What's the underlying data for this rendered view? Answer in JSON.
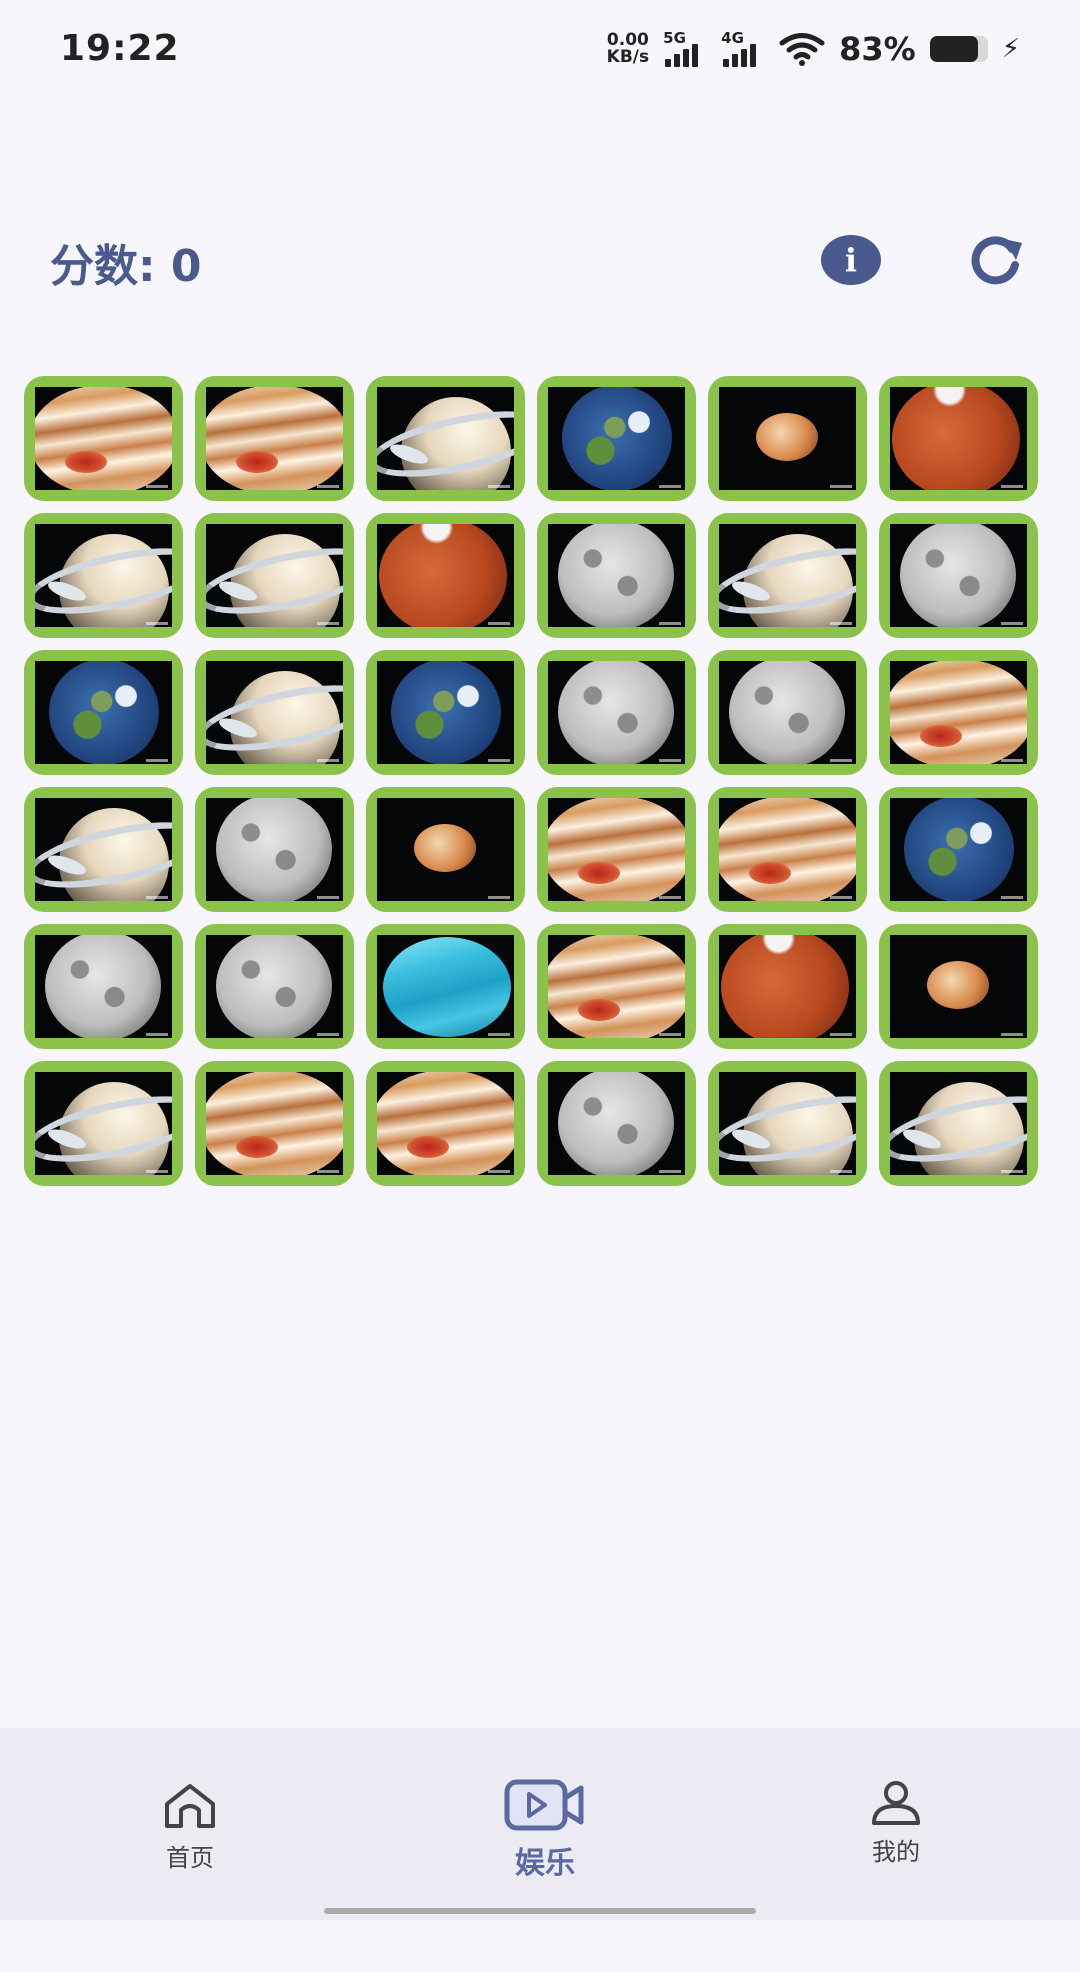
{
  "status_bar": {
    "time": "19:22",
    "net_speed_value": "0.00",
    "net_speed_unit": "KB/s",
    "signal_1_label": "5G",
    "signal_2_label": "4G",
    "battery_percent": "83%",
    "battery_level": 0.83,
    "icons": [
      "wifi-icon",
      "battery-icon",
      "charging-bolt-icon"
    ]
  },
  "header": {
    "score_label": "分数: 0",
    "info_label": "i",
    "icons": [
      "info-icon",
      "refresh-icon"
    ]
  },
  "grid": {
    "columns": 6,
    "rows": 6,
    "border_color": "#8bc34a",
    "cards": [
      [
        "jupiter",
        "jupiter",
        "saturn",
        "earth",
        "mars-mini",
        "mars"
      ],
      [
        "saturn",
        "saturn",
        "mars",
        "moon",
        "saturn",
        "moon"
      ],
      [
        "earth",
        "saturn",
        "earth",
        "moon",
        "moon",
        "jupiter"
      ],
      [
        "saturn",
        "moon",
        "mars-mini",
        "jupiter",
        "jupiter",
        "earth"
      ],
      [
        "moon",
        "moon",
        "uranus",
        "jupiter",
        "mars",
        "mars-mini"
      ],
      [
        "saturn",
        "jupiter",
        "jupiter",
        "moon",
        "saturn",
        "saturn"
      ]
    ]
  },
  "tabbar": {
    "tabs": [
      {
        "label": "首页",
        "icon": "home-icon",
        "active": false
      },
      {
        "label": "娱乐",
        "icon": "video-icon",
        "active": true
      },
      {
        "label": "我的",
        "icon": "user-icon",
        "active": false
      }
    ],
    "accent": "#5a6aa0"
  }
}
